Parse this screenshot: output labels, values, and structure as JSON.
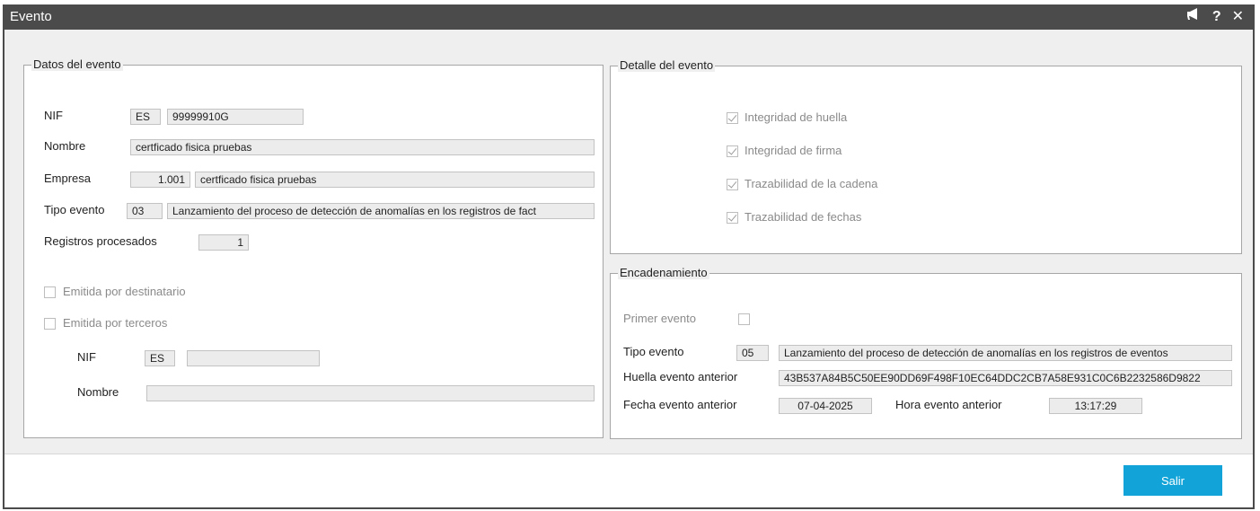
{
  "window": {
    "title": "Evento"
  },
  "titlebar_icons": {
    "notify": "megaphone-icon",
    "help": "?",
    "close": "✕"
  },
  "datos": {
    "legend": "Datos del evento",
    "nif_label": "NIF",
    "nif_country": "ES",
    "nif_value": "99999910G",
    "nombre_label": "Nombre",
    "nombre_value": "certficado fisica pruebas",
    "empresa_label": "Empresa",
    "empresa_code": "1.001",
    "empresa_name": "certficado fisica pruebas",
    "tipo_label": "Tipo evento",
    "tipo_code": "03",
    "tipo_desc": "Lanzamiento del proceso de detección de anomalías en los registros de fact",
    "registros_label": "Registros procesados",
    "registros_value": "1",
    "emitida_dest_label": "Emitida por destinatario",
    "emitida_terc_label": "Emitida por terceros",
    "sub_nif_label": "NIF",
    "sub_nif_country": "ES",
    "sub_nif_value": "",
    "sub_nombre_label": "Nombre",
    "sub_nombre_value": ""
  },
  "detalle": {
    "legend": "Detalle del evento",
    "checks": [
      {
        "label": "Integridad de huella",
        "checked": true
      },
      {
        "label": "Integridad de firma",
        "checked": true
      },
      {
        "label": "Trazabilidad de la cadena",
        "checked": true
      },
      {
        "label": "Trazabilidad de fechas",
        "checked": true
      }
    ]
  },
  "encad": {
    "legend": "Encadenamiento",
    "primer_label": "Primer evento",
    "tipo_label": "Tipo evento",
    "tipo_code": "05",
    "tipo_desc": "Lanzamiento del proceso de detección de anomalías en los registros de eventos",
    "huella_label": "Huella evento anterior",
    "huella_value": "43B537A84B5C50EE90DD69F498F10EC64DDC2CB7A58E931C0C6B2232586D9822",
    "fecha_label": "Fecha evento anterior",
    "fecha_value": "07-04-2025",
    "hora_label": "Hora evento anterior",
    "hora_value": "13:17:29"
  },
  "footer": {
    "salir_label": "Salir"
  }
}
